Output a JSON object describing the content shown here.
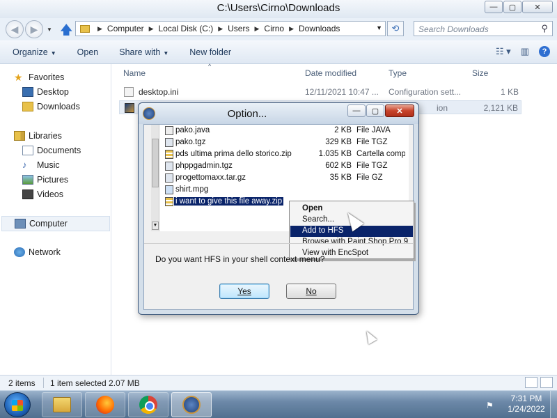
{
  "window": {
    "title": "C:\\Users\\Cirno\\Downloads",
    "minimize": "—",
    "maximize": "▢",
    "close": "✕"
  },
  "address": {
    "crumbs": [
      "Computer",
      "Local Disk (C:)",
      "Users",
      "Cirno",
      "Downloads"
    ],
    "search_placeholder": "Search Downloads"
  },
  "toolbar": {
    "organize": "Organize",
    "open": "Open",
    "share_with": "Share with",
    "new_folder": "New folder"
  },
  "nav": {
    "favorites": "Favorites",
    "desktop": "Desktop",
    "downloads": "Downloads",
    "libraries": "Libraries",
    "documents": "Documents",
    "music": "Music",
    "pictures": "Pictures",
    "videos": "Videos",
    "computer": "Computer",
    "network": "Network"
  },
  "columns": {
    "name": "Name",
    "date": "Date modified",
    "type": "Type",
    "size": "Size"
  },
  "files": [
    {
      "name": "desktop.ini",
      "date": "12/11/2021 10:47 ...",
      "type": "Configuration sett...",
      "size": "1 KB"
    },
    {
      "name": "",
      "date": "",
      "type": "ion",
      "size": "2,121 KB"
    }
  ],
  "status": {
    "items": "2 items",
    "selected": "1 item selected  2.07 MB"
  },
  "taskbar": {
    "time": "7:31 PM",
    "date": "1/24/2022"
  },
  "dialog": {
    "title": "Option...",
    "icon": "hfs-icon",
    "question": "Do you want HFS in your shell context menu?",
    "yes": "Yes",
    "no": "No",
    "shot_files": [
      {
        "name": "pako.java",
        "size": "2 KB",
        "type": "File JAVA",
        "icon": "java"
      },
      {
        "name": "pako.tgz",
        "size": "329 KB",
        "type": "File TGZ",
        "icon": "tgz"
      },
      {
        "name": "pds ultima prima dello storico.zip",
        "size": "1.035 KB",
        "type": "Cartella compr",
        "icon": "zip"
      },
      {
        "name": "phppgadmin.tgz",
        "size": "602 KB",
        "type": "File TGZ",
        "icon": "tgz"
      },
      {
        "name": "progettomaxx.tar.gz",
        "size": "35 KB",
        "type": "File GZ",
        "icon": "tgz"
      },
      {
        "name": "shirt.mpg",
        "size": "",
        "type": "",
        "icon": "mpg"
      },
      {
        "name": "i want to give this file away.zip",
        "size": "",
        "type": "",
        "icon": "zip"
      }
    ],
    "context_menu": [
      {
        "label": "Open",
        "bold": true
      },
      {
        "label": "Search...",
        "bold": false
      },
      {
        "label": "Add to HFS",
        "bold": false,
        "highlighted": true
      },
      {
        "label": "Browse with Paint Shop Pro 9",
        "bold": false
      },
      {
        "label": "View with EncSpot",
        "bold": false
      }
    ]
  }
}
